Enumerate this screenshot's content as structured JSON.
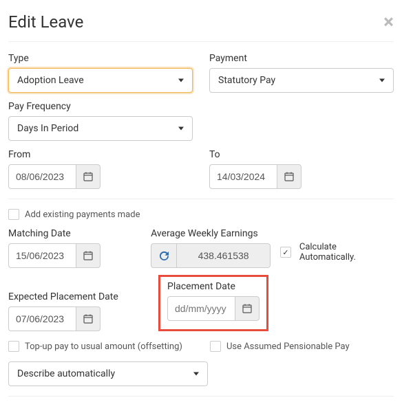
{
  "header": {
    "title": "Edit Leave"
  },
  "type": {
    "label": "Type",
    "value": "Adoption Leave"
  },
  "payment": {
    "label": "Payment",
    "value": "Statutory Pay"
  },
  "payfreq": {
    "label": "Pay Frequency",
    "value": "Days In Period"
  },
  "from": {
    "label": "From",
    "value": "08/06/2023"
  },
  "to": {
    "label": "To",
    "value": "14/03/2024"
  },
  "addExisting": {
    "label": "Add existing payments made"
  },
  "matching": {
    "label": "Matching Date",
    "value": "15/06/2023"
  },
  "awe": {
    "label": "Average Weekly Earnings",
    "value": "438.461538"
  },
  "calcAuto": {
    "label": "Calculate Automatically."
  },
  "expected": {
    "label": "Expected Placement Date",
    "value": "07/06/2023"
  },
  "placement": {
    "label": "Placement Date",
    "placeholder": "dd/mm/yyyy"
  },
  "topup": {
    "label": "Top-up pay to usual amount (offsetting)"
  },
  "assumed": {
    "label": "Use Assumed Pensionable Pay"
  },
  "describe": {
    "value": "Describe automatically"
  }
}
